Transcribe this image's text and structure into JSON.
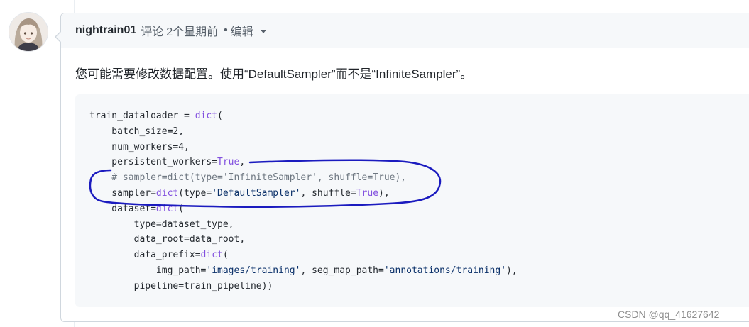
{
  "comment": {
    "author": "nightrain01",
    "action": "评论",
    "time": "2个星期前",
    "separator": "•",
    "edited": "编辑",
    "body": "您可能需要修改数据配置。使用“DefaultSampler”而不是“InfiniteSampler”。"
  },
  "code": {
    "lines": [
      [
        {
          "t": "train_dataloader = "
        },
        {
          "t": "dict",
          "c": "kw"
        },
        {
          "t": "("
        }
      ],
      [
        {
          "t": "    batch_size=2,"
        }
      ],
      [
        {
          "t": "    num_workers=4,"
        }
      ],
      [
        {
          "t": "    persistent_workers="
        },
        {
          "t": "True",
          "c": "kw"
        },
        {
          "t": ","
        }
      ],
      [
        {
          "t": "    # sampler=dict(type='InfiniteSampler', shuffle=True),",
          "c": "cm"
        }
      ],
      [
        {
          "t": "    sampler="
        },
        {
          "t": "dict",
          "c": "kw"
        },
        {
          "t": "(type="
        },
        {
          "t": "'DefaultSampler'",
          "c": "str"
        },
        {
          "t": ", shuffle="
        },
        {
          "t": "True",
          "c": "kw"
        },
        {
          "t": "),"
        }
      ],
      [
        {
          "t": "    dataset="
        },
        {
          "t": "dict",
          "c": "kw"
        },
        {
          "t": "("
        }
      ],
      [
        {
          "t": "        type=dataset_type,"
        }
      ],
      [
        {
          "t": "        data_root=data_root,"
        }
      ],
      [
        {
          "t": "        data_prefix="
        },
        {
          "t": "dict",
          "c": "kw"
        },
        {
          "t": "("
        }
      ],
      [
        {
          "t": "            img_path="
        },
        {
          "t": "'images/training'",
          "c": "str"
        },
        {
          "t": ", seg_map_path="
        },
        {
          "t": "'annotations/training'",
          "c": "str"
        },
        {
          "t": "),"
        }
      ],
      [
        {
          "t": "        pipeline=train_pipeline))"
        }
      ]
    ]
  },
  "annotation": {
    "color": "#1b1bbf"
  },
  "watermark": "CSDN @qq_41627642",
  "colors": {
    "header_bg": "#f6f8fa",
    "border": "#d0d7de",
    "code_bg": "#f6f8fa",
    "keyword": "#8250df",
    "comment": "#6e7781",
    "string": "#0a3069"
  }
}
